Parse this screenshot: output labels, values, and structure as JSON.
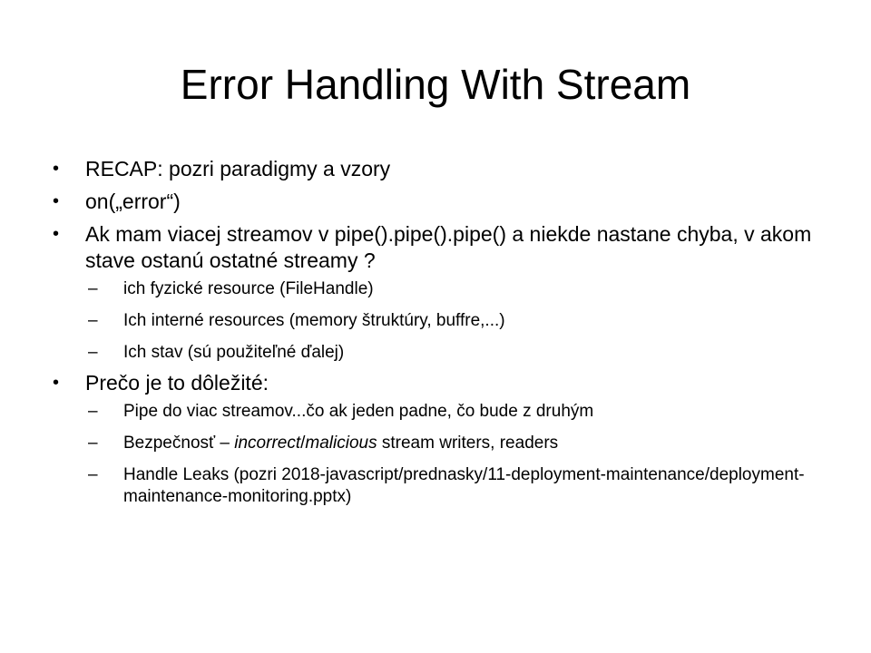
{
  "slide": {
    "title": "Error Handling With Stream",
    "bullet_glyph": "•",
    "dash_glyph": "–",
    "items": [
      {
        "text": "RECAP: pozri paradigmy a vzory"
      },
      {
        "text": "on(„error“)"
      },
      {
        "text": "Ak mam viacej streamov v pipe().pipe().pipe()  a niekde nastane chyba, v akom stave ostanú ostatné streamy ?",
        "sub": [
          {
            "text": "ich fyzické resource (FileHandle)"
          },
          {
            "text": "Ich interné resources (memory štruktúry, buffre,...)"
          },
          {
            "text": "Ich stav (sú použiteľné ďalej)"
          }
        ]
      },
      {
        "text": "Prečo je to dôležité:",
        "sub": [
          {
            "text": "Pipe do viac streamov...čo ak jeden padne, čo bude z druhým"
          },
          {
            "parts": {
              "a": "Bezpečnosť – ",
              "b": "incorrect",
              "c": "/",
              "d": "malicious",
              "e": " stream writers, readers"
            }
          },
          {
            "text": "Handle Leaks (pozri 2018-javascript/prednasky/11-deployment-maintenance/deployment-maintenance-monitoring.pptx)"
          }
        ]
      }
    ]
  }
}
